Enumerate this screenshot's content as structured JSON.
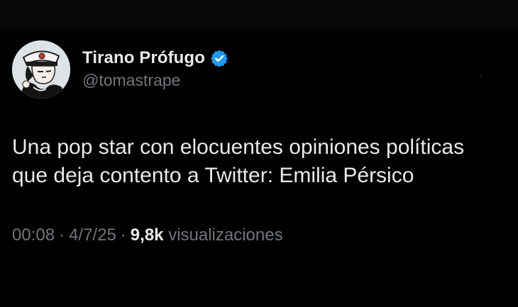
{
  "author": {
    "display_name": "Tirano Prófugo",
    "handle": "@tomastrape",
    "verified": true,
    "verified_color": "#1d9bf0",
    "avatar_icon": "cartoon-sailor-avatar"
  },
  "tweet": {
    "text_lines": [
      "Una pop star con elocuentes opiniones políticas",
      "que deja contento a Twitter: Emilia Pérsico"
    ]
  },
  "meta": {
    "time": "00:08",
    "separator": "·",
    "date": "4/7/25",
    "views_count": "9,8k",
    "views_label": "visualizaciones"
  },
  "colors": {
    "background": "#000000",
    "primary_text": "#e7e9ea",
    "secondary_text": "#71767b"
  }
}
